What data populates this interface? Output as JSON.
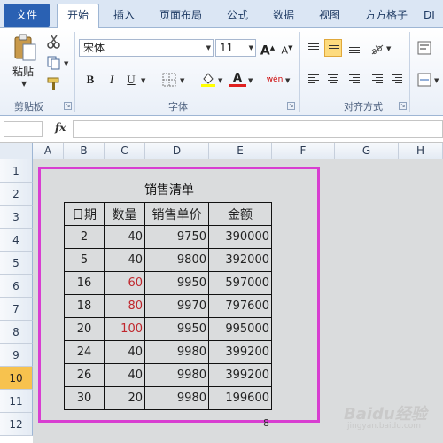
{
  "tabs": {
    "file": "文件",
    "home": "开始",
    "insert": "插入",
    "layout": "页面布局",
    "formula": "公式",
    "data": "数据",
    "view": "视图",
    "addin": "方方格子",
    "more": "DI"
  },
  "ribbon": {
    "paste_label": "粘贴",
    "clipboard_label": "剪贴板",
    "font_label": "字体",
    "align_label": "对齐方式",
    "font_name": "宋体",
    "font_size": "11",
    "bold": "B",
    "italic": "I",
    "underline": "U",
    "grow_font": "A",
    "shrink_font": "A",
    "font_color_letter": "A",
    "phonetic": "wén"
  },
  "formula_bar": {
    "fx": "fx",
    "value": ""
  },
  "columns": [
    "A",
    "B",
    "C",
    "D",
    "E",
    "F",
    "G",
    "H"
  ],
  "rows": [
    "1",
    "2",
    "3",
    "4",
    "5",
    "6",
    "7",
    "8",
    "9",
    "10",
    "11",
    "12"
  ],
  "selected_row": "10",
  "sheet": {
    "title": "销售清单",
    "headers": [
      "日期",
      "数量",
      "销售单价",
      "金额"
    ],
    "rows": [
      {
        "date": "2",
        "qty": "40",
        "price": "9750",
        "amount": "390000"
      },
      {
        "date": "5",
        "qty": "40",
        "price": "9800",
        "amount": "392000"
      },
      {
        "date": "16",
        "qty": "60",
        "price": "9950",
        "amount": "597000"
      },
      {
        "date": "18",
        "qty": "80",
        "price": "9970",
        "amount": "797600"
      },
      {
        "date": "20",
        "qty": "100",
        "price": "9950",
        "amount": "995000"
      },
      {
        "date": "24",
        "qty": "40",
        "price": "9980",
        "amount": "399200"
      },
      {
        "date": "26",
        "qty": "40",
        "price": "9980",
        "amount": "399200"
      },
      {
        "date": "30",
        "qty": "20",
        "price": "9980",
        "amount": "199600"
      }
    ],
    "red_rows": [
      2,
      3,
      4
    ],
    "page_number": "8"
  },
  "colors": {
    "highlight_border": "#d83ed1",
    "red_text": "#c0272d",
    "selected_row_header": "#f7c24e",
    "file_tab": "#2a61b3"
  },
  "watermark": {
    "text": "Baidu经验",
    "sub": "jingyan.baidu.com"
  }
}
